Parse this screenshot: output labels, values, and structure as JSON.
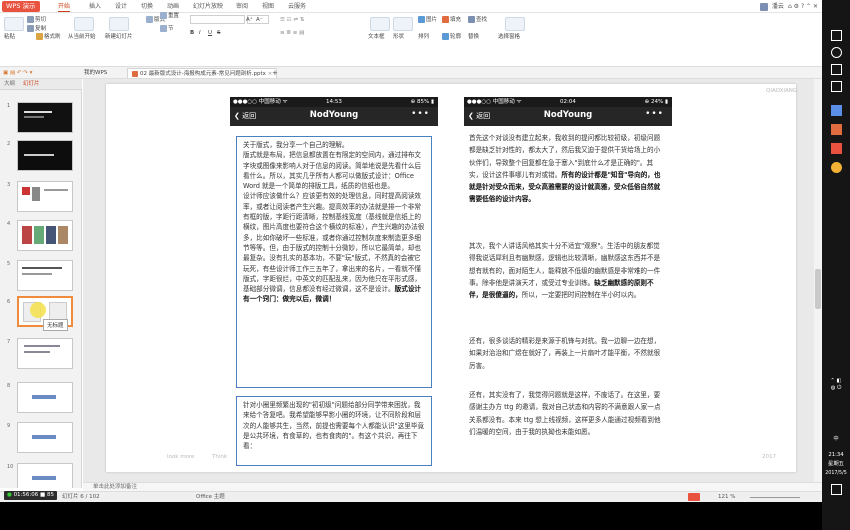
{
  "titlebar": {
    "app": "WPS 演示",
    "tabs": [
      "开始",
      "插入",
      "设计",
      "切换",
      "动画",
      "幻灯片放映",
      "审阅",
      "视图",
      "云服务"
    ],
    "active_tab": "开始",
    "user": "潘云",
    "right_glyphs": "⌂ ⚙ ? ⌃ ✕"
  },
  "ribbon": {
    "paste": "粘贴",
    "cut": "剪切",
    "copy": "复制",
    "format_painter": "格式刷",
    "from_current": "从当前开始",
    "new_slide": "新建幻灯片",
    "layout": "版式",
    "reset": "重置",
    "section": "节",
    "font_size_up": "A⁺",
    "font_size_down": "A⁻",
    "bold": "B",
    "italic": "I",
    "underline": "U",
    "strike": "S",
    "textbox": "文本框",
    "shape": "形状",
    "arrange": "排列",
    "picture": "图片",
    "fill": "填充",
    "outline": "轮廓",
    "find": "查找",
    "replace": "替换",
    "select_pane": "选择窗格"
  },
  "doc": {
    "my_wps": "我的WPS",
    "tab": "02 最新版式设计-海报构成元素-常见问题剖析.pptx",
    "add": "+"
  },
  "panel": {
    "outline": "大纲",
    "slides": "幻灯片",
    "tooltip": "无标题",
    "numbers": [
      "1",
      "2",
      "3",
      "4",
      "5",
      "6",
      "7",
      "8",
      "9",
      "10"
    ]
  },
  "left_phone": {
    "carrier": "●●●○○ 中国移动 ᯤ",
    "time": "14:53",
    "battery": "⊕ 85% ▮",
    "back": "返回",
    "title": "NodYoung",
    "more": "•••"
  },
  "right_phone": {
    "carrier": "●●●○○ 中国移动 ᯤ",
    "time": "02:04",
    "battery": "⊕ 24% ▮",
    "back": "返回",
    "title": "NodYoung",
    "more": "•••"
  },
  "left_block1": {
    "text": "关于版式，我分享一个自己的理解。\n版式就是布局，把信息都放置在有限定的空间内，通过排布文字块或图像来影响人对于信息的阅读。简单地说是先看什么后看什么。所以，其实几乎所有人都可以做版式设计：Office Word 就是一个简单的排版工具，纸质的信纸也是。\n设计师应该做什么？应该更有效的处理信息，同时提高阅读效率，或者让阅读者产生兴趣。提高效率的办法就是排一个非常有框的版，字距行距清晰，控制基线宽度（基线就是信纸上的横纹，图片高度也要符合这个横纹的标准），产生兴趣的办法很多，比如你破坏一些标准，或者你通过控制灰度来制造更多细节等等。但，由于版式的控制十分微妙，所以它最简单，却也最复杂。没有扎实的基本功，不要\"玩\"版式，不然真的会被它玩死，有些设计师工作三五年了，拿出来的名片，一看就不懂版式，字距很烂，中英文的匹配乱来，因为他只在平形式感，基础部分微调，信息都没有经过微调，这不是设计。",
    "bold": "版式设计有一个窍门：做完以后，微调！"
  },
  "left_block2": {
    "text": "针对小圈里频繁出现的\"初初级\"问题给部分同学带来困扰，我来给个答复吧。我希望能够早影小圈的环境，让不同阶段和层次的人能够共生，当然，前提也需要每个人都能认识\"这里毕竟是公共环境，有食草的，也有食肉的\"。有这个共识，再往下看："
  },
  "right_para1": {
    "text": "首先这个对谈没有建立起来，我收到的提问都比较初级，初级问题都是缺乏针对性的，都太大了，然后我又迫于提供干货给场上的小伙伴们，导致整个回复都在急于塞入\"到底什么才是正确的\"。其实，设计这件事哪儿有对或错。",
    "bold": "所有的设计都是\"知音\"导向的，也就是针对受众而来，受众高雅需要的设计就高雅，受众低俗自然就需要低俗的设计内容。"
  },
  "right_para2": {
    "text": "其次，我个人讲话风格其实十分不适宜\"观察\"。生活中的朋友都觉得我说话犀利且有幽默感，逻辑也比较清晰，幽默感这东西并不是想有就有的，面对陌生人，能释放不低级的幽默感是非常难的一件事。除非他是讲演天才，或受过专业训练。",
    "bold": "缺乏幽默感的原则不伴，是很傻逼的，",
    "tail": "所以，一定要把时间控制在半小时以内。"
  },
  "right_para3": {
    "text": "还有，很多谈话的精彩是来源于机锋与对抗。我一边聊一边在想，如果对治治和广煜在就好了，再装上一片扇叶才能平衡，不然就很厉害。"
  },
  "right_para4": {
    "text": "还有，其实没有了，我觉得问题就是这样，不废话了。在这里，要感谢主办方 ttg 的邀请，我对自己状态和内容的不满意跟人家一点关系都没有。本来 ttg 想上线视频，这样更多人能通过视频看到他们温暖的空间，由于我的执拗也未能如愿。"
  },
  "watermarks": {
    "top_right": "QIAOXIANG",
    "bottom_left": "look more",
    "bottom_mid": "Think",
    "bottom_right": "2017"
  },
  "notes": {
    "text": "单击此处添加备注"
  },
  "status": {
    "rec": "01:56:06 ■ 85",
    "slide": "幻灯片 6 / 102",
    "theme": "Office 主题",
    "zoom": "121 %"
  },
  "rail": {
    "time": "21:34",
    "weekday": "星期五",
    "date": "2017/5/5",
    "lang": "中"
  }
}
